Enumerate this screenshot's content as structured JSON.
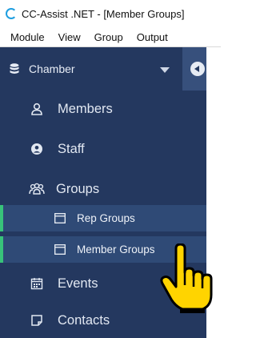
{
  "window": {
    "title": "CC-Assist .NET - [Member Groups]"
  },
  "menu": [
    "Module",
    "View",
    "Group",
    "Output"
  ],
  "sidebar": {
    "org_label": "Chamber",
    "items": [
      {
        "label": "Members",
        "icon": "user-icon"
      },
      {
        "label": "Staff",
        "icon": "user-circle-icon"
      },
      {
        "label": "Groups",
        "icon": "group-icon"
      }
    ],
    "sub_items": [
      {
        "label": "Rep Groups",
        "icon": "window-icon"
      },
      {
        "label": "Member Groups",
        "icon": "window-icon"
      }
    ],
    "bottom_items": [
      {
        "label": "Events",
        "icon": "calendar-icon"
      },
      {
        "label": "Contacts",
        "icon": "note-icon"
      }
    ]
  },
  "colors": {
    "sidebar_bg": "#24385f",
    "sub_bg": "#2f4a76",
    "accent": "#38c37a",
    "pointer": "#ffd400"
  }
}
